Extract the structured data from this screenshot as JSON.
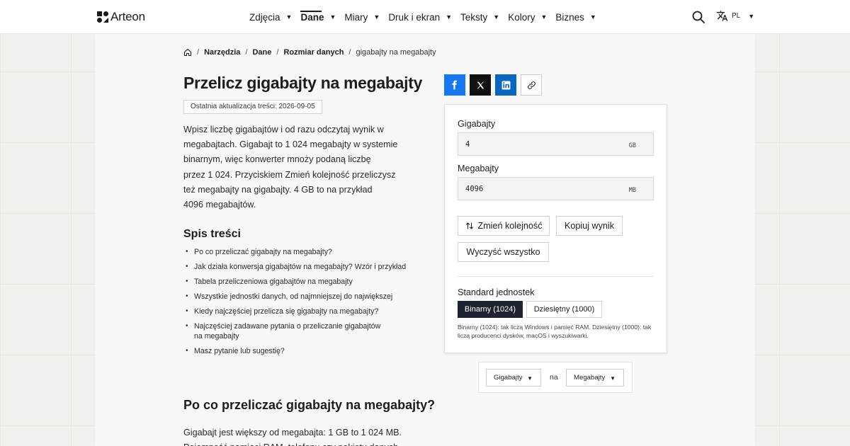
{
  "header": {
    "logo_text": "Arteon",
    "nav": [
      {
        "label": "Zdjęcia",
        "active": false
      },
      {
        "label": "Dane",
        "active": true
      },
      {
        "label": "Miary",
        "active": false
      },
      {
        "label": "Druk i ekran",
        "active": false
      },
      {
        "label": "Teksty",
        "active": false
      },
      {
        "label": "Kolory",
        "active": false
      },
      {
        "label": "Biznes",
        "active": false
      }
    ],
    "caret": "▼",
    "language": "PL"
  },
  "breadcrumb": {
    "items": [
      "Narzędzia",
      "Dane",
      "Rozmiar danych"
    ],
    "current": "gigabajty na megabajty",
    "separator": "/"
  },
  "page": {
    "title": "Przelicz gigabajty na megabajty",
    "updated": "Ostatnia aktualizacja treści: 2026-09-05",
    "intro_lines": [
      "Wpisz liczbę gigabajtów i od razu odczytaj wynik w",
      "megabajtach. Gigabajt to 1 024 megabajty w systemie",
      "binarnym, więc konwerter mnoży podaną liczbę",
      "przez 1 024. Przyciskiem Zmień kolejność przeliczysz",
      "też megabajty na gigabajty. 4 GB to na przykład",
      "4096 megabajtów."
    ]
  },
  "toc": {
    "title": "Spis treści",
    "items": [
      "Po co przeliczać gigabajty na megabajty?",
      "Jak działa konwersja gigabajtów na megabajty? Wzór i przykład",
      "Tabela przeliczeniowa gigabajtów na megabajty",
      "Wszystkie jednostki danych, od najmniejszej do największej",
      "Kiedy najczęściej przelicza się gigabajty na megabajty?",
      "Najczęściej zadawane pytania o przeliczanie gigabajtów",
      "Masz pytanie lub sugestię?"
    ],
    "item6_line2": "na megabajty"
  },
  "section": {
    "title": "Po co przeliczać gigabajty na megabajty?",
    "text": "Gigabajt jest większy od megabajta: 1 GB to 1 024 MB.",
    "text_partial": "Pojemność pamięci RAM, telefonu czy pakietu danych"
  },
  "converter": {
    "from_label": "Gigabajty",
    "from_value": "4",
    "from_unit": "GB",
    "to_label": "Megabajty",
    "to_value": "4096",
    "to_unit": "MB",
    "swap_label": "Zmień kolejność",
    "copy_label": "Kopiuj wynik",
    "clear_label": "Wyczyść wszystko",
    "standard_label": "Standard jednostek",
    "standard_binary": "Binarny (1024)",
    "standard_decimal": "Dziesiętny (1000)",
    "standard_note": "Binarny (1024): tak liczą Windows i pamięć RAM. Dziesiętny (1000): tak liczą producenci dysków, macOS i wyszukiwarki."
  },
  "unit_picker": {
    "from": "Gigabajty",
    "connector": "na",
    "to": "Megabajty"
  },
  "colors": {
    "facebook": "#1877f2",
    "x": "#111111",
    "linkedin": "#0a66c2",
    "active_segment": "#1f2230"
  }
}
